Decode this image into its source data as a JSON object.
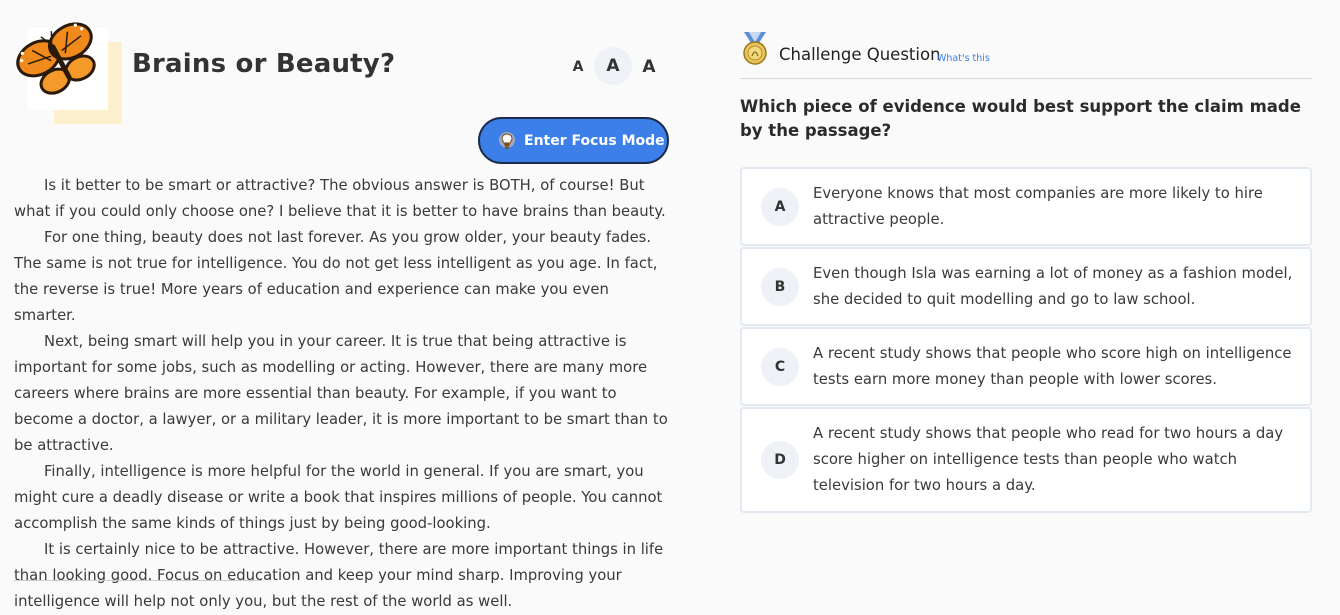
{
  "article": {
    "title": "Brains or Beauty?",
    "thumbnail_icon": "butterfly-icon",
    "font_size_options": [
      "A",
      "A",
      "A"
    ],
    "focus_button_label": "Enter Focus Mode",
    "paragraphs": [
      "Is it better to be smart or attractive? The obvious answer is BOTH, of course! But what if you could only choose one? I believe that it is better to have brains than beauty.",
      "For one thing, beauty does not last forever. As you grow older, your beauty fades. The same is not true for intelligence. You do not get less intelligent as you age. In fact, the reverse is true! More years of education and experience can make you even smarter.",
      "Next, being smart will help you in your career. It is true that being attractive is important for some jobs, such as modelling or acting. However, there are many more careers where brains are more essential than beauty. For example, if you want to become a doctor, a lawyer, or a military leader, it is more important to be smart than to be attractive.",
      "Finally, intelligence is more helpful for the world in general. If you are smart, you might cure a deadly disease or write a book that inspires millions of people. You cannot accomplish the same kinds of things just by being good-looking.",
      "It is certainly nice to be attractive. However, there are more important things in life than looking good. Focus on education and keep your mind sharp. Improving your intelligence will help not only you, but the rest of the world as well."
    ]
  },
  "challenge": {
    "icon": "medal-icon",
    "heading": "Challenge Question",
    "help_link": "What's this",
    "question": "Which piece of evidence would best support the claim made by the passage?",
    "choices": [
      {
        "letter": "A",
        "text": "Everyone knows that most companies are more likely to hire attractive people."
      },
      {
        "letter": "B",
        "text": "Even though Isla was earning a lot of money as a fashion model, she decided to quit modelling and go to law school."
      },
      {
        "letter": "C",
        "text": "A recent study shows that people who score high on intelligence tests earn more money than people with lower scores."
      },
      {
        "letter": "D",
        "text": "A recent study shows that people who read for two hours a day score higher on intelligence tests than people who watch television for two hours a day."
      }
    ]
  },
  "colors": {
    "accent": "#3c7fe8",
    "background": "#fafafa",
    "choice_border": "#e3e9f2"
  }
}
